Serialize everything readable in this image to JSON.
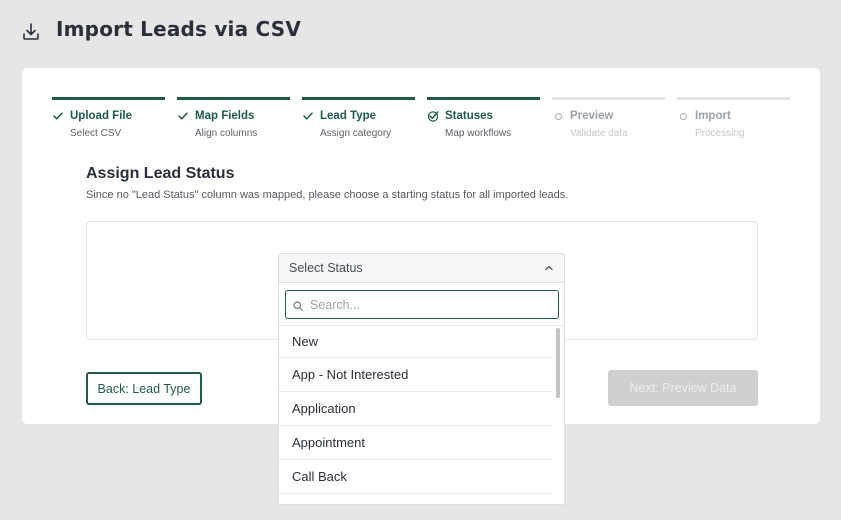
{
  "header": {
    "title": "Import Leads via CSV",
    "icon": "download-icon"
  },
  "steps": [
    {
      "title": "Upload File",
      "subtitle": "Select CSV",
      "state": "complete"
    },
    {
      "title": "Map Fields",
      "subtitle": "Align columns",
      "state": "complete"
    },
    {
      "title": "Lead Type",
      "subtitle": "Assign category",
      "state": "complete"
    },
    {
      "title": "Statuses",
      "subtitle": "Map workflows",
      "state": "current"
    },
    {
      "title": "Preview",
      "subtitle": "Validate data",
      "state": "pending"
    },
    {
      "title": "Import",
      "subtitle": "Processing",
      "state": "pending"
    }
  ],
  "section": {
    "title": "Assign Lead Status",
    "description": "Since no \"Lead Status\" column was mapped, please choose a starting status for all imported leads."
  },
  "select": {
    "value": "Select Status",
    "search_placeholder": "Search...",
    "options": [
      "New",
      "App - Not Interested",
      "Application",
      "Appointment",
      "Call Back"
    ]
  },
  "buttons": {
    "back": "Back: Lead Type",
    "next": "Next: Preview Data"
  },
  "colors": {
    "accent": "#1d5b4c",
    "background": "#e6e6e6",
    "disabled": "#cfcfcf"
  }
}
